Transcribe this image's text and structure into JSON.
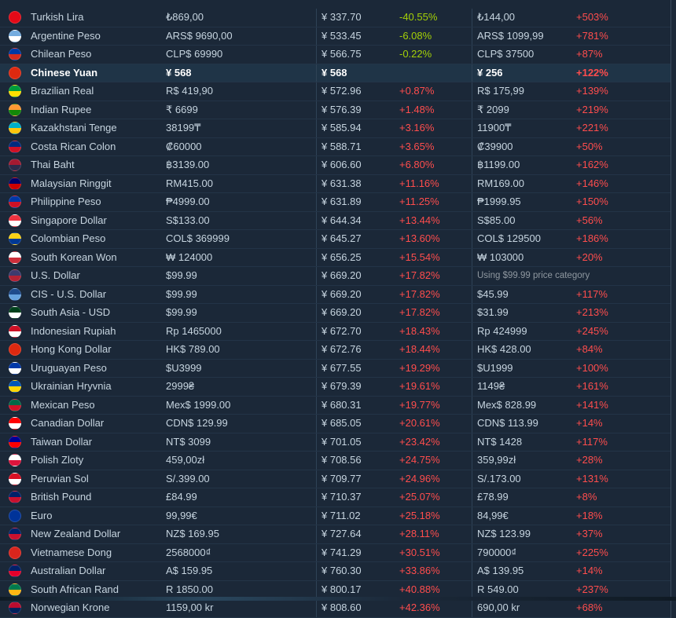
{
  "rows": [
    {
      "name": "Turkish Lira",
      "price": "₺869,00",
      "yen": "¥ 337.70",
      "pct": "-40.55%",
      "rec": "₺144,00",
      "rpct": "+503%",
      "flag": [
        "#e30a17",
        "#e30a17"
      ]
    },
    {
      "name": "Argentine Peso",
      "price": "ARS$ 9690,00",
      "yen": "¥ 533.45",
      "pct": "-6.08%",
      "rec": "ARS$ 1099,99",
      "rpct": "+781%",
      "flag": [
        "#74acdf",
        "#ffffff"
      ]
    },
    {
      "name": "Chilean Peso",
      "price": "CLP$ 69990",
      "yen": "¥ 566.75",
      "pct": "-0.22%",
      "rec": "CLP$ 37500",
      "rpct": "+87%",
      "flag": [
        "#0039a6",
        "#d52b1e"
      ]
    },
    {
      "name": "Chinese Yuan",
      "price": "¥ 568",
      "yen": "¥ 568",
      "pct": "",
      "rec": "¥ 256",
      "rpct": "+122%",
      "flag": [
        "#de2910",
        "#de2910"
      ],
      "bold": true
    },
    {
      "name": "Brazilian Real",
      "price": "R$ 419,90",
      "yen": "¥ 572.96",
      "pct": "+0.87%",
      "rec": "R$ 175,99",
      "rpct": "+139%",
      "flag": [
        "#009c3b",
        "#ffdf00"
      ]
    },
    {
      "name": "Indian Rupee",
      "price": "₹ 6699",
      "yen": "¥ 576.39",
      "pct": "+1.48%",
      "rec": "₹ 2099",
      "rpct": "+219%",
      "flag": [
        "#ff9933",
        "#138808"
      ]
    },
    {
      "name": "Kazakhstani Tenge",
      "price": "38199₸",
      "yen": "¥ 585.94",
      "pct": "+3.16%",
      "rec": "11900₸",
      "rpct": "+221%",
      "flag": [
        "#00afca",
        "#fec50c"
      ]
    },
    {
      "name": "Costa Rican Colon",
      "price": "₡60000",
      "yen": "¥ 588.71",
      "pct": "+3.65%",
      "rec": "₡39900",
      "rpct": "+50%",
      "flag": [
        "#002b7f",
        "#ce1126"
      ]
    },
    {
      "name": "Thai Baht",
      "price": "฿3139.00",
      "yen": "¥ 606.60",
      "pct": "+6.80%",
      "rec": "฿1199.00",
      "rpct": "+162%",
      "flag": [
        "#a51931",
        "#2d2a4a"
      ]
    },
    {
      "name": "Malaysian Ringgit",
      "price": "RM415.00",
      "yen": "¥ 631.38",
      "pct": "+11.16%",
      "rec": "RM169.00",
      "rpct": "+146%",
      "flag": [
        "#010066",
        "#cc0001"
      ]
    },
    {
      "name": "Philippine Peso",
      "price": "₱4999.00",
      "yen": "¥ 631.89",
      "pct": "+11.25%",
      "rec": "₱1999.95",
      "rpct": "+150%",
      "flag": [
        "#0038a8",
        "#ce1126"
      ]
    },
    {
      "name": "Singapore Dollar",
      "price": "S$133.00",
      "yen": "¥ 644.34",
      "pct": "+13.44%",
      "rec": "S$85.00",
      "rpct": "+56%",
      "flag": [
        "#ef3340",
        "#ffffff"
      ]
    },
    {
      "name": "Colombian Peso",
      "price": "COL$ 369999",
      "yen": "¥ 645.27",
      "pct": "+13.60%",
      "rec": "COL$ 129500",
      "rpct": "+186%",
      "flag": [
        "#fcd116",
        "#003893"
      ]
    },
    {
      "name": "South Korean Won",
      "price": "₩ 124000",
      "yen": "¥ 656.25",
      "pct": "+15.54%",
      "rec": "₩ 103000",
      "rpct": "+20%",
      "flag": [
        "#ffffff",
        "#cd2e3a"
      ]
    },
    {
      "name": "U.S. Dollar",
      "price": "$99.99",
      "yen": "¥ 669.20",
      "pct": "+17.82%",
      "note": "Using $99.99 price category",
      "flag": [
        "#3c3b6e",
        "#b22234"
      ]
    },
    {
      "name": "CIS - U.S. Dollar",
      "price": "$99.99",
      "yen": "¥ 669.20",
      "pct": "+17.82%",
      "rec": "$45.99",
      "rpct": "+117%",
      "flag": [
        "#1e4b8c",
        "#66a3e0"
      ]
    },
    {
      "name": "South Asia - USD",
      "price": "$99.99",
      "yen": "¥ 669.20",
      "pct": "+17.82%",
      "rec": "$31.99",
      "rpct": "+213%",
      "flag": [
        "#01411c",
        "#ffffff"
      ]
    },
    {
      "name": "Indonesian Rupiah",
      "price": "Rp 1465000",
      "yen": "¥ 672.70",
      "pct": "+18.43%",
      "rec": "Rp 424999",
      "rpct": "+245%",
      "flag": [
        "#ce1126",
        "#ffffff"
      ]
    },
    {
      "name": "Hong Kong Dollar",
      "price": "HK$ 789.00",
      "yen": "¥ 672.76",
      "pct": "+18.44%",
      "rec": "HK$ 428.00",
      "rpct": "+84%",
      "flag": [
        "#de2910",
        "#de2910"
      ]
    },
    {
      "name": "Uruguayan Peso",
      "price": "$U3999",
      "yen": "¥ 677.55",
      "pct": "+19.29%",
      "rec": "$U1999",
      "rpct": "+100%",
      "flag": [
        "#0038a8",
        "#ffffff"
      ]
    },
    {
      "name": "Ukrainian Hryvnia",
      "price": "2999₴",
      "yen": "¥ 679.39",
      "pct": "+19.61%",
      "rec": "1149₴",
      "rpct": "+161%",
      "flag": [
        "#0057b7",
        "#ffd700"
      ]
    },
    {
      "name": "Mexican Peso",
      "price": "Mex$ 1999.00",
      "yen": "¥ 680.31",
      "pct": "+19.77%",
      "rec": "Mex$ 828.99",
      "rpct": "+141%",
      "flag": [
        "#006847",
        "#ce1126"
      ]
    },
    {
      "name": "Canadian Dollar",
      "price": "CDN$ 129.99",
      "yen": "¥ 685.05",
      "pct": "+20.61%",
      "rec": "CDN$ 113.99",
      "rpct": "+14%",
      "flag": [
        "#ff0000",
        "#ffffff"
      ]
    },
    {
      "name": "Taiwan Dollar",
      "price": "NT$ 3099",
      "yen": "¥ 701.05",
      "pct": "+23.42%",
      "rec": "NT$ 1428",
      "rpct": "+117%",
      "flag": [
        "#000095",
        "#fe0000"
      ]
    },
    {
      "name": "Polish Zloty",
      "price": "459,00zł",
      "yen": "¥ 708.56",
      "pct": "+24.75%",
      "rec": "359,99zł",
      "rpct": "+28%",
      "flag": [
        "#ffffff",
        "#dc143c"
      ]
    },
    {
      "name": "Peruvian Sol",
      "price": "S/.399.00",
      "yen": "¥ 709.77",
      "pct": "+24.96%",
      "rec": "S/.173.00",
      "rpct": "+131%",
      "flag": [
        "#d91023",
        "#ffffff"
      ]
    },
    {
      "name": "British Pound",
      "price": "£84.99",
      "yen": "¥ 710.37",
      "pct": "+25.07%",
      "rec": "£78.99",
      "rpct": "+8%",
      "flag": [
        "#012169",
        "#c8102e"
      ]
    },
    {
      "name": "Euro",
      "price": "99,99€",
      "yen": "¥ 711.02",
      "pct": "+25.18%",
      "rec": "84,99€",
      "rpct": "+18%",
      "flag": [
        "#003399",
        "#003399"
      ]
    },
    {
      "name": "New Zealand Dollar",
      "price": "NZ$ 169.95",
      "yen": "¥ 727.64",
      "pct": "+28.11%",
      "rec": "NZ$ 123.99",
      "rpct": "+37%",
      "flag": [
        "#012169",
        "#c8102e"
      ]
    },
    {
      "name": "Vietnamese Dong",
      "price": "2568000₫",
      "yen": "¥ 741.29",
      "pct": "+30.51%",
      "rec": "790000₫",
      "rpct": "+225%",
      "flag": [
        "#da251d",
        "#da251d"
      ]
    },
    {
      "name": "Australian Dollar",
      "price": "A$ 159.95",
      "yen": "¥ 760.30",
      "pct": "+33.86%",
      "rec": "A$ 139.95",
      "rpct": "+14%",
      "flag": [
        "#012169",
        "#e4002b"
      ]
    },
    {
      "name": "South African Rand",
      "price": "R 1850.00",
      "yen": "¥ 800.17",
      "pct": "+40.88%",
      "rec": "R 549.00",
      "rpct": "+237%",
      "flag": [
        "#007a4d",
        "#ffb612"
      ]
    },
    {
      "name": "Norwegian Krone",
      "price": "1159,00 kr",
      "yen": "¥ 808.60",
      "pct": "+42.36%",
      "rec": "690,00 kr",
      "rpct": "+68%",
      "flag": [
        "#ba0c2f",
        "#00205b"
      ]
    }
  ]
}
